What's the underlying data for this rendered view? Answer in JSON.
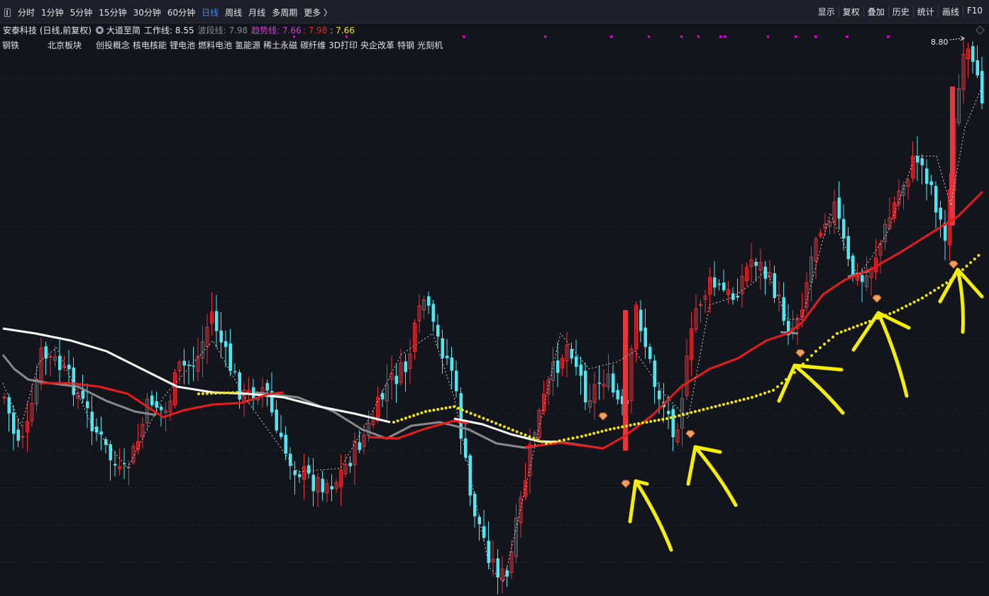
{
  "toolbar": {
    "periods": [
      "分时",
      "1分钟",
      "5分钟",
      "15分钟",
      "30分钟",
      "60分钟",
      "日线",
      "周线",
      "月线",
      "多周期",
      "更多 〉"
    ],
    "active_period": "日线",
    "tools": [
      "显示",
      "复权",
      "叠加",
      "历史",
      "统计",
      "画线",
      "F10"
    ]
  },
  "info": {
    "stock": "安泰科技 (日线,前复权)",
    "indicator": "大道至简",
    "work_line": "工作线: 8.55",
    "wave_line": "波段线: 7.98",
    "trend_line": "趋势线: 7.66",
    "trend_second": ": 7.98",
    "yellow_value": ": 7.66"
  },
  "concepts": [
    "钢铁",
    "北京板块",
    "创投概念",
    "核电核能",
    "锂电池",
    "燃料电池",
    "氢能源",
    "稀土永磁",
    "碳纤维",
    "3D打印",
    "央企改革",
    "特钢",
    "光刻机"
  ],
  "colors": {
    "bg": "#13151c",
    "up": "#e8343d",
    "down": "#4ee6f0",
    "white_line": "#ffffff",
    "gray_line": "#8a8a8a",
    "red_line": "#e81c1c",
    "yellow_dots": "#f5e600",
    "magenta_marks": "#e000e0",
    "arrow": "#f5ee00"
  },
  "chart_data": {
    "type": "candlestick",
    "high_label": "8.80",
    "signal_icon": "diamond-gem-icon",
    "annotation": "hand-drawn yellow arrows pointing at buy signals"
  }
}
